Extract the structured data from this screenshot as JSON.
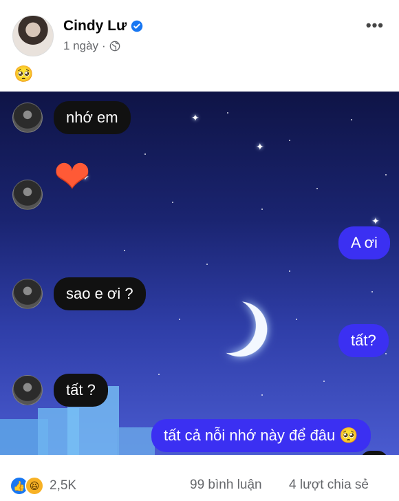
{
  "post": {
    "author": "Cindy Lư",
    "time": "1 ngày",
    "separator": "·",
    "emoji": "🥺",
    "more_label": "•••"
  },
  "chat": {
    "messages": [
      {
        "side": "left",
        "text": "nhớ em"
      },
      {
        "side": "left",
        "text": "❤"
      },
      {
        "side": "right",
        "text": "A ơi"
      },
      {
        "side": "left",
        "text": "sao e ơi ?"
      },
      {
        "side": "right",
        "text": "tất?"
      },
      {
        "side": "left",
        "text": "tất ?"
      },
      {
        "side": "right",
        "text": "tất cả nỗi nhớ này để đâu 🥺"
      }
    ],
    "reaction": "❤"
  },
  "footer": {
    "reactions_count": "2,5K",
    "comments": "99 bình luận",
    "shares": "4 lượt chia sẻ"
  },
  "colors": {
    "outgoing_bubble": "#3b30f2",
    "incoming_bubble": "#111111",
    "like": "#1877f2"
  }
}
